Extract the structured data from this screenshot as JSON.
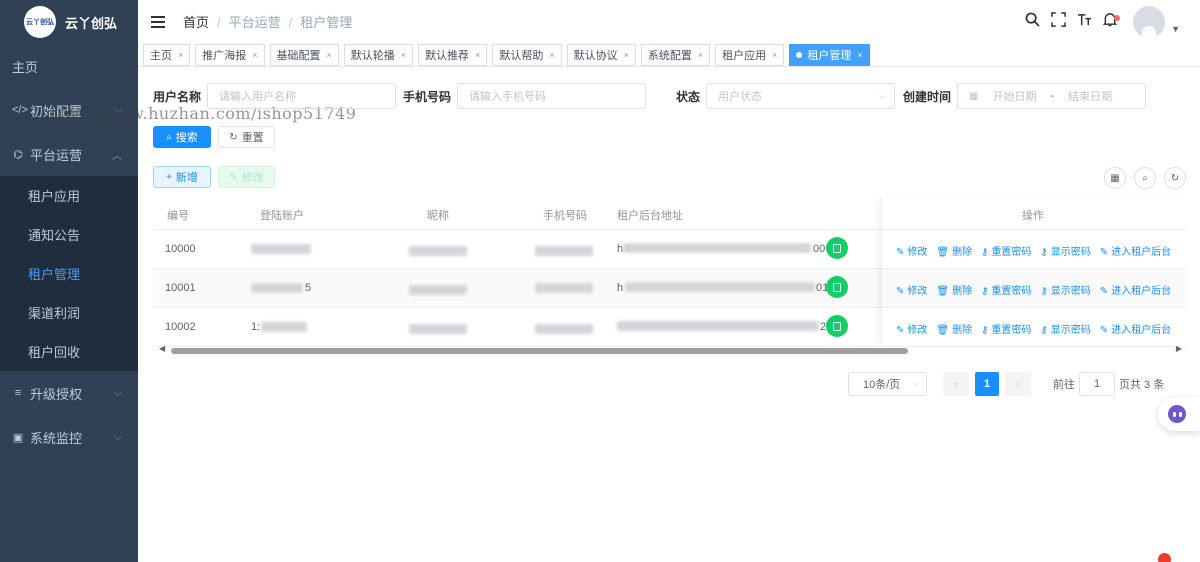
{
  "logo": {
    "badge": "云丫创弘",
    "text": "云丫创弘"
  },
  "sidebar": {
    "home": "主页",
    "items": [
      {
        "label": "初始配置",
        "icon": "code-icon"
      },
      {
        "label": "平台运营",
        "icon": "operation-icon"
      }
    ],
    "submenu": [
      "租户应用",
      "通知公告",
      "租户管理",
      "渠道利润",
      "租户回收"
    ],
    "bottom_items": [
      {
        "label": "升级授权",
        "icon": "list-icon"
      },
      {
        "label": "系统监控",
        "icon": "monitor-icon"
      }
    ]
  },
  "watermark": "https://www.huzhan.com/ishop51749",
  "breadcrumb": [
    "首页",
    "平台运营",
    "租户管理"
  ],
  "tags": [
    "主页",
    "推广海报",
    "基础配置",
    "默认轮播",
    "默认推荐",
    "默认帮助",
    "默认协议",
    "系统配置",
    "租户应用",
    "租户管理"
  ],
  "search": {
    "username_label": "用户名称",
    "username_placeholder": "请输入用户名称",
    "phone_label": "手机号码",
    "phone_placeholder": "请输入手机号码",
    "status_label": "状态",
    "status_placeholder": "用户状态",
    "created_label": "创建时间",
    "start_placeholder": "开始日期",
    "date_sep": "-",
    "end_placeholder": "结束日期",
    "search_btn": "搜索",
    "reset_btn": "重置"
  },
  "toolbar": {
    "add_btn": "新增",
    "edit_btn": "修改"
  },
  "table": {
    "columns": [
      "编号",
      "登陆账户",
      "昵称",
      "手机号码",
      "租户后台地址",
      "操作"
    ],
    "rows": [
      {
        "id": "10000",
        "account": "",
        "url_start": "h",
        "url_end": "00"
      },
      {
        "id": "10001",
        "account": "5",
        "url_start": "h",
        "url_end": "01"
      },
      {
        "id": "10002",
        "account": "1:",
        "url_start": "",
        "url_end": "2"
      }
    ],
    "actions": [
      "修改",
      "删除",
      "重置密码",
      "显示密码",
      "进入租户后台"
    ]
  },
  "pagination": {
    "page_size": "10条/页",
    "current_page": "1",
    "goto_label": "前往",
    "goto_value": "1",
    "total": "页共 3 条"
  },
  "colors": {
    "sidebar_bg": "#304156",
    "primary": "#1890ff",
    "active_menu": "#409eff",
    "success": "#13ce66"
  }
}
